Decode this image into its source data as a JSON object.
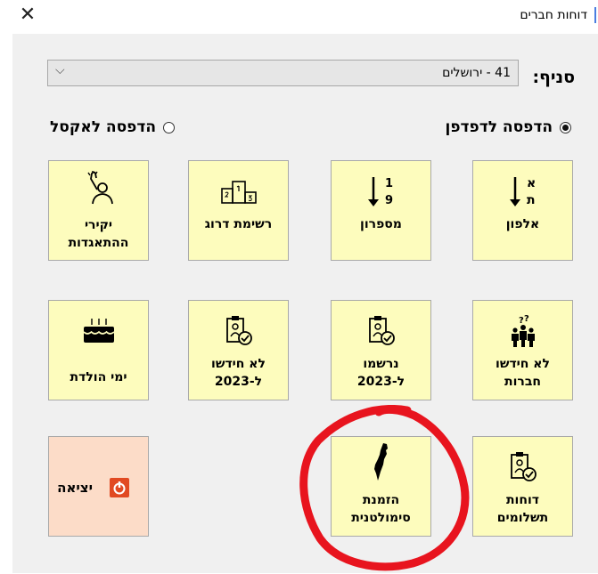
{
  "window": {
    "title": "דוחות חברים",
    "close_icon": "close-icon"
  },
  "branch": {
    "label": "סניף:",
    "selected": "41 - ירושלים"
  },
  "output": {
    "browser_label": "הדפסה לדפדפן",
    "excel_label": "הדפסה לאקסל",
    "selected": "browser"
  },
  "tiles": {
    "alphabetical": "אלפון",
    "numerical": "מספרון",
    "ranking_list": "רשימת דרוג",
    "association_dear": "יקירי\nההתאגדות",
    "not_renewed_members": "לא חידשו\nחברות",
    "registered_2023": "נרשמו\nל-2023",
    "not_renewed_2023": "לא חידשו\nל-2023",
    "birthdays": "ימי הולדת",
    "payment_reports": "דוחות\nתשלומים",
    "simultaneous": "הזמנת\nסימולטנית",
    "exit": "יציאה"
  },
  "icon_text": {
    "alpha_top": "א",
    "alpha_bottom": "ת",
    "num_top": "1",
    "num_bottom": "9"
  },
  "colors": {
    "tile_bg": "#fdfcbd",
    "exit_bg": "#fcdcc8",
    "annotation_red": "#e8141e",
    "exit_icon": "#e14a22"
  }
}
